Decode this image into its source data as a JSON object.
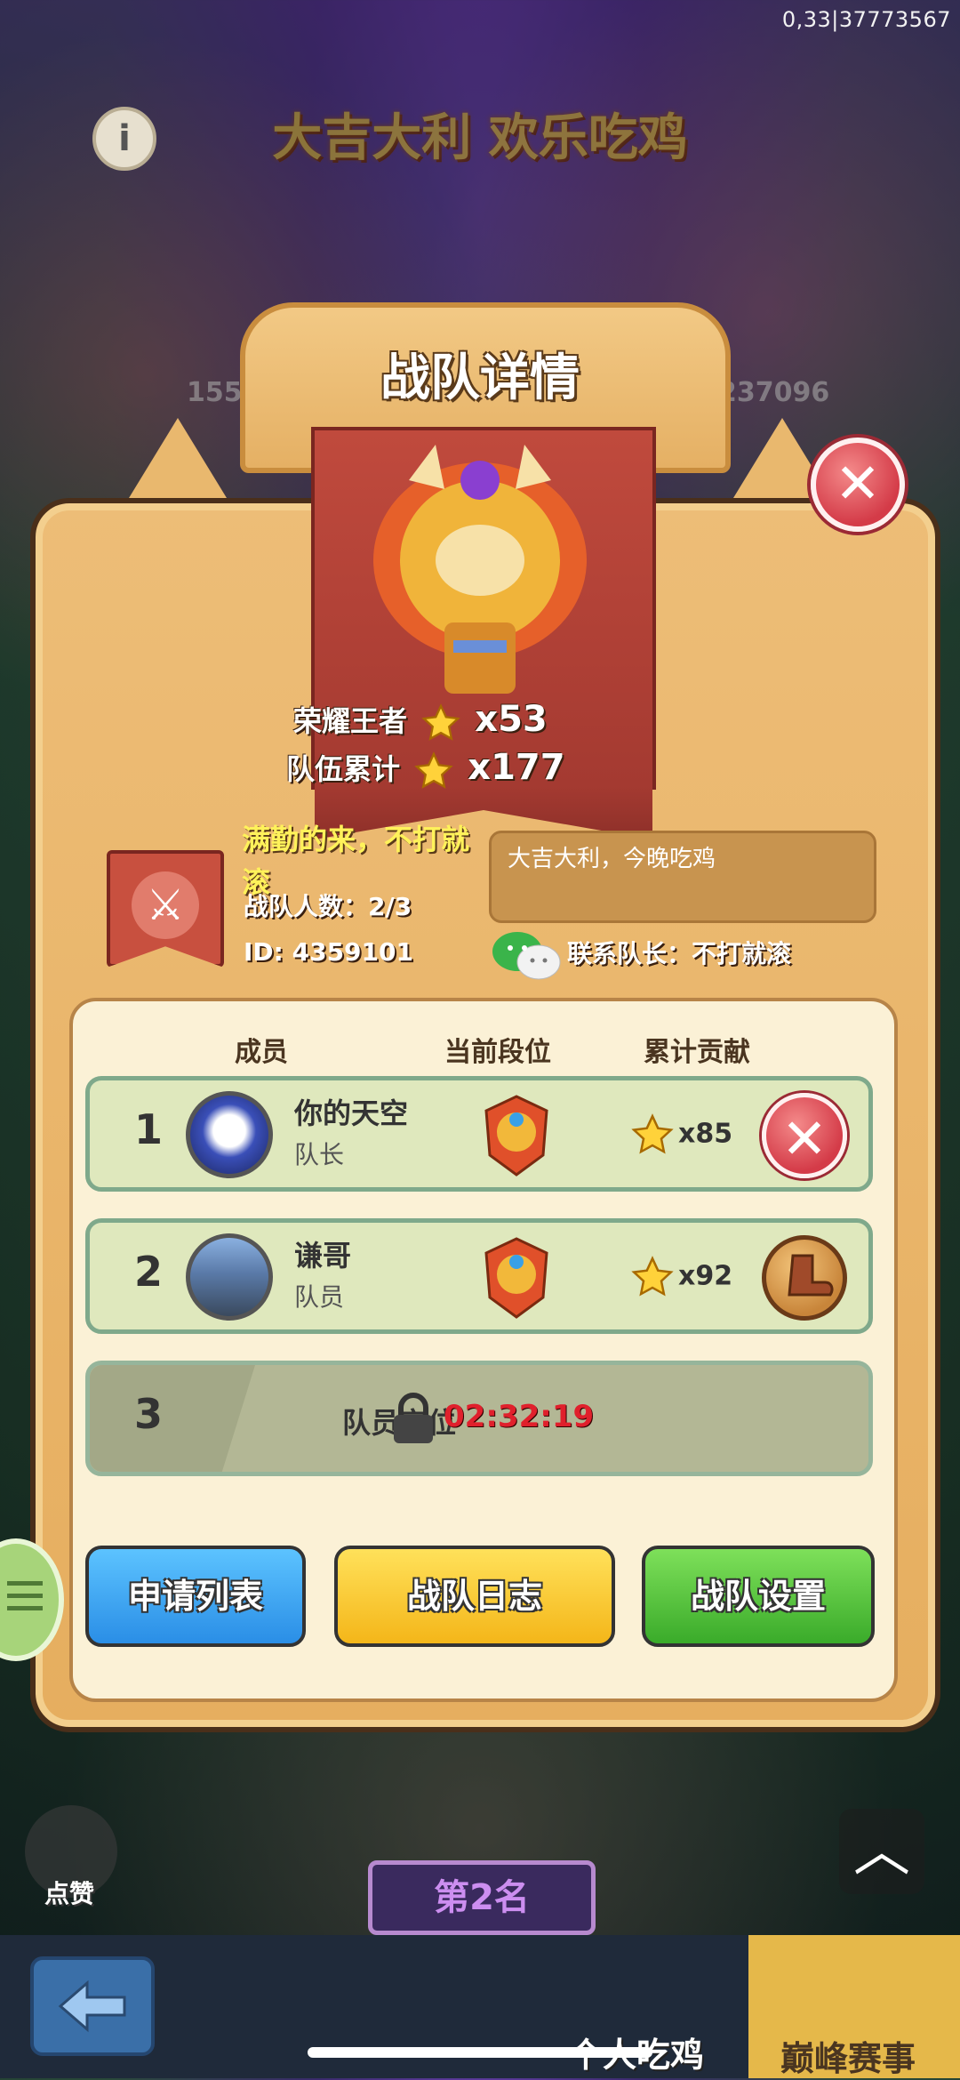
{
  "status_bar": {
    "info": "0,33|37773567"
  },
  "event": {
    "title": "大吉大利  欢乐吃鸡",
    "left_count": "155",
    "right_count": "237096"
  },
  "dialog": {
    "title": "战队详情",
    "honor": {
      "label": "荣耀王者",
      "value": "x53"
    },
    "total": {
      "label": "队伍累计",
      "value": "x177"
    }
  },
  "team": {
    "name": "满勤的来，不打就滚",
    "count": "战队人数：2/3",
    "id": "ID: 4359101",
    "motto": "大吉大利，今晚吃鸡",
    "contact": "联系队长：不打就滚"
  },
  "table": {
    "headers": {
      "member": "成员",
      "rank": "当前段位",
      "contrib": "累计贡献"
    },
    "rows": [
      {
        "num": "1",
        "name": "你的天空",
        "role": "队长",
        "stars": "x85"
      },
      {
        "num": "2",
        "name": "谦哥",
        "role": "队员",
        "stars": "x92"
      }
    ],
    "locked": {
      "num": "3",
      "text": "队员空位",
      "timer": "02:32:19"
    }
  },
  "buttons": {
    "apply_list": "申请列表",
    "team_log": "战队日志",
    "team_settings": "战队设置"
  },
  "bottom": {
    "like": "点赞",
    "rank_label": "第2名",
    "tab_solo": "个人吃鸡",
    "tab_peak": "巅峰赛事"
  },
  "colors": {
    "panel": "#e6ae5f",
    "close_red": "#d43b48",
    "btn_blue": "#2a8ee6",
    "btn_yellow": "#f4b619",
    "btn_green": "#3aab2a"
  }
}
